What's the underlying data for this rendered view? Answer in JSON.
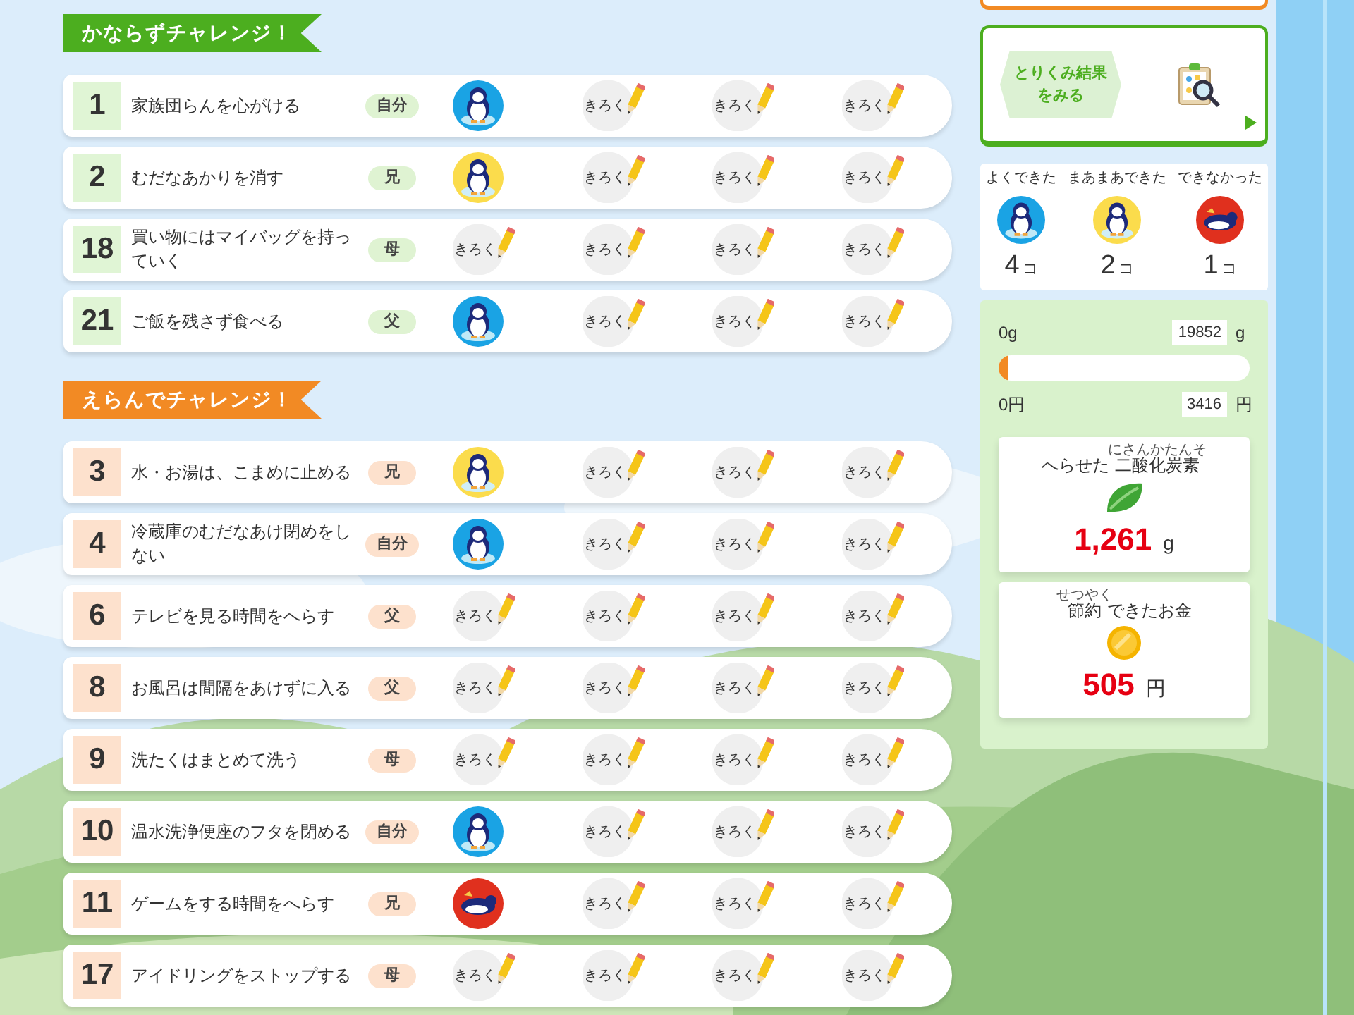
{
  "sections": [
    {
      "title": "かならずチャレンジ！",
      "kind": "green",
      "rows": [
        {
          "number": "1",
          "text": "家族団らんを心がける",
          "who": "自分",
          "cells": [
            {
              "kind": "good"
            },
            {
              "kind": "record",
              "label": "きろく"
            },
            {
              "kind": "record",
              "label": "きろく"
            },
            {
              "kind": "record",
              "label": "きろく"
            }
          ]
        },
        {
          "number": "2",
          "text": "むだなあかりを消す",
          "who": "兄",
          "cells": [
            {
              "kind": "ok"
            },
            {
              "kind": "record",
              "label": "きろく"
            },
            {
              "kind": "record",
              "label": "きろく"
            },
            {
              "kind": "record",
              "label": "きろく"
            }
          ]
        },
        {
          "number": "18",
          "text": "買い物にはマイバッグを持っていく",
          "who": "母",
          "cells": [
            {
              "kind": "record",
              "label": "きろく"
            },
            {
              "kind": "record",
              "label": "きろく"
            },
            {
              "kind": "record",
              "label": "きろく"
            },
            {
              "kind": "record",
              "label": "きろく"
            }
          ]
        },
        {
          "number": "21",
          "text": "ご飯を残さず食べる",
          "who": "父",
          "cells": [
            {
              "kind": "good"
            },
            {
              "kind": "record",
              "label": "きろく"
            },
            {
              "kind": "record",
              "label": "きろく"
            },
            {
              "kind": "record",
              "label": "きろく"
            }
          ]
        }
      ]
    },
    {
      "title": "えらんでチャレンジ！",
      "kind": "orange",
      "rows": [
        {
          "number": "3",
          "text": "水・お湯は、こまめに止める",
          "who": "兄",
          "cells": [
            {
              "kind": "ok"
            },
            {
              "kind": "record",
              "label": "きろく"
            },
            {
              "kind": "record",
              "label": "きろく"
            },
            {
              "kind": "record",
              "label": "きろく"
            }
          ]
        },
        {
          "number": "4",
          "text": "冷蔵庫のむだなあけ閉めをしない",
          "who": "自分",
          "cells": [
            {
              "kind": "good"
            },
            {
              "kind": "record",
              "label": "きろく"
            },
            {
              "kind": "record",
              "label": "きろく"
            },
            {
              "kind": "record",
              "label": "きろく"
            }
          ]
        },
        {
          "number": "6",
          "text": "テレビを見る時間をへらす",
          "who": "父",
          "cells": [
            {
              "kind": "record",
              "label": "きろく"
            },
            {
              "kind": "record",
              "label": "きろく"
            },
            {
              "kind": "record",
              "label": "きろく"
            },
            {
              "kind": "record",
              "label": "きろく"
            }
          ]
        },
        {
          "number": "8",
          "text": "お風呂は間隔をあけずに入る",
          "who": "父",
          "cells": [
            {
              "kind": "record",
              "label": "きろく"
            },
            {
              "kind": "record",
              "label": "きろく"
            },
            {
              "kind": "record",
              "label": "きろく"
            },
            {
              "kind": "record",
              "label": "きろく"
            }
          ]
        },
        {
          "number": "9",
          "text": "洗たくはまとめて洗う",
          "who": "母",
          "cells": [
            {
              "kind": "record",
              "label": "きろく"
            },
            {
              "kind": "record",
              "label": "きろく"
            },
            {
              "kind": "record",
              "label": "きろく"
            },
            {
              "kind": "record",
              "label": "きろく"
            }
          ]
        },
        {
          "number": "10",
          "text": "温水洗浄便座のフタを閉める",
          "who": "自分",
          "cells": [
            {
              "kind": "good"
            },
            {
              "kind": "record",
              "label": "きろく"
            },
            {
              "kind": "record",
              "label": "きろく"
            },
            {
              "kind": "record",
              "label": "きろく"
            }
          ]
        },
        {
          "number": "11",
          "text": "ゲームをする時間をへらす",
          "who": "兄",
          "cells": [
            {
              "kind": "bad"
            },
            {
              "kind": "record",
              "label": "きろく"
            },
            {
              "kind": "record",
              "label": "きろく"
            },
            {
              "kind": "record",
              "label": "きろく"
            }
          ]
        },
        {
          "number": "17",
          "text": "アイドリングをストップする",
          "who": "母",
          "cells": [
            {
              "kind": "record",
              "label": "きろく"
            },
            {
              "kind": "record",
              "label": "きろく"
            },
            {
              "kind": "record",
              "label": "きろく"
            },
            {
              "kind": "record",
              "label": "きろく"
            }
          ]
        }
      ]
    }
  ],
  "results_button": {
    "line_1": "とりくみ結果",
    "line_2": "をみる"
  },
  "tally": [
    {
      "label": "よくできた",
      "kind": "good",
      "count": "4",
      "unit": "コ"
    },
    {
      "label": "まあまあできた",
      "kind": "ok",
      "count": "2",
      "unit": "コ"
    },
    {
      "label": "できなかった",
      "kind": "bad",
      "count": "1",
      "unit": "コ"
    }
  ],
  "progress": {
    "start_weight": "0g",
    "goal_weight": "19852",
    "weight_unit": "g",
    "level": 0.04,
    "start_money": "0円",
    "goal_money": "3416",
    "money_unit": "円"
  },
  "totals": [
    {
      "kind": "leaf",
      "title": [
        {
          "text": "へらせた"
        },
        {
          "text": "二酸化炭素",
          "ruby": "にさんかたんそ"
        }
      ],
      "value": "1,261",
      "unit": "g"
    },
    {
      "kind": "coin",
      "title": [
        {
          "text": "節約",
          "ruby": "せつやく"
        },
        {
          "text": "できたお金"
        }
      ],
      "value": "505",
      "unit": "円"
    }
  ]
}
